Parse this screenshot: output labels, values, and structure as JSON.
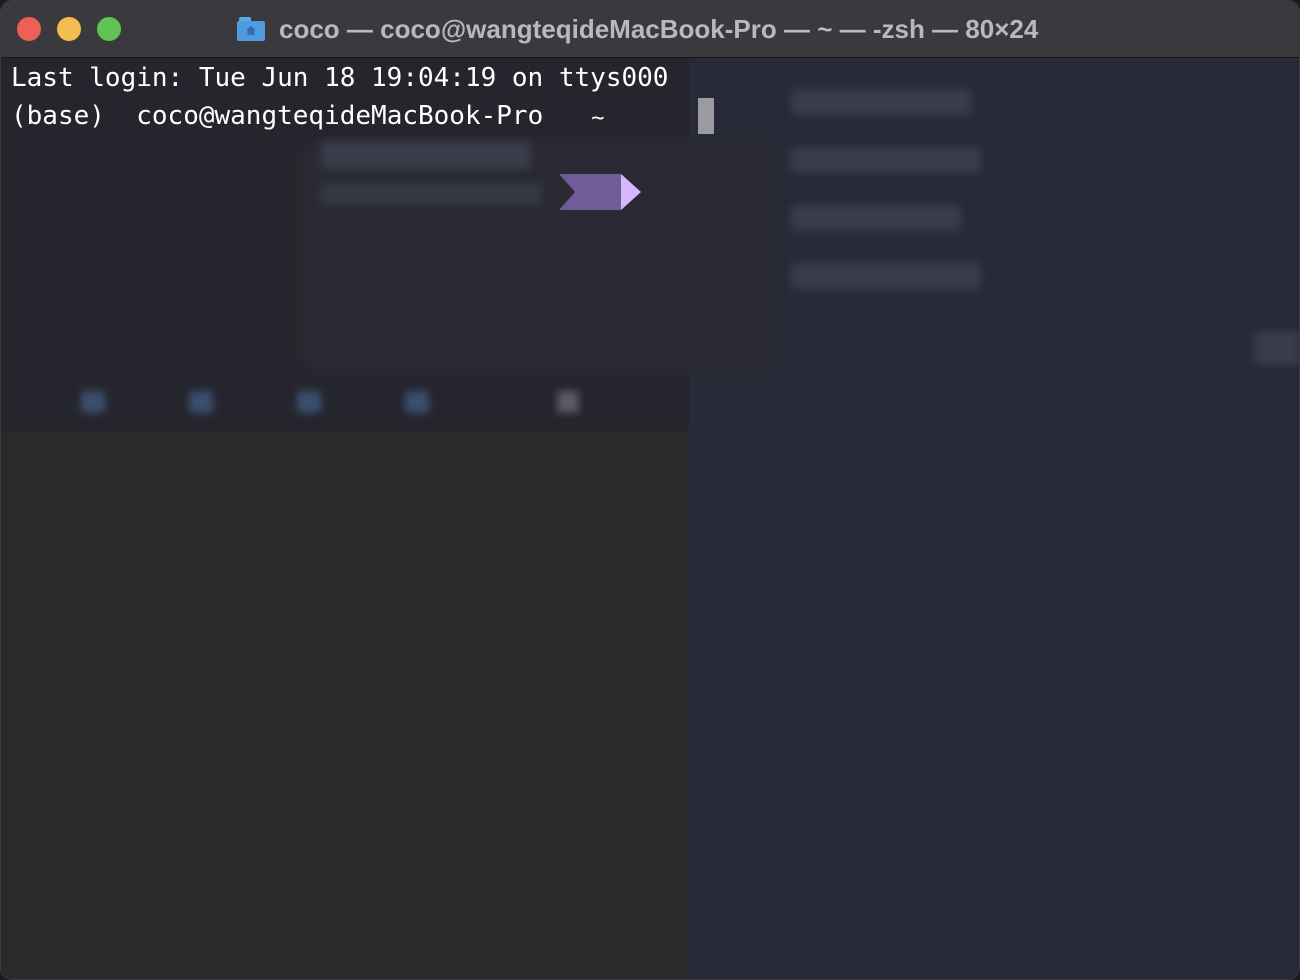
{
  "window": {
    "title": "coco — coco@wangteqideMacBook-Pro — ~ — -zsh — 80×24",
    "icon": "home-folder-icon"
  },
  "terminal": {
    "lines": [
      "Last login: Tue Jun 18 19:04:19 on ttys000"
    ],
    "prompt": {
      "env": "(base)",
      "user_host": "coco@wangteqideMacBook-Pro",
      "cwd": "~"
    }
  },
  "colors": {
    "prompt_segment": "#6f5d9a",
    "prompt_arrow": "#d6b8ff",
    "cursor": "#9a9aa0",
    "titlebar": "#3a3a3e"
  }
}
